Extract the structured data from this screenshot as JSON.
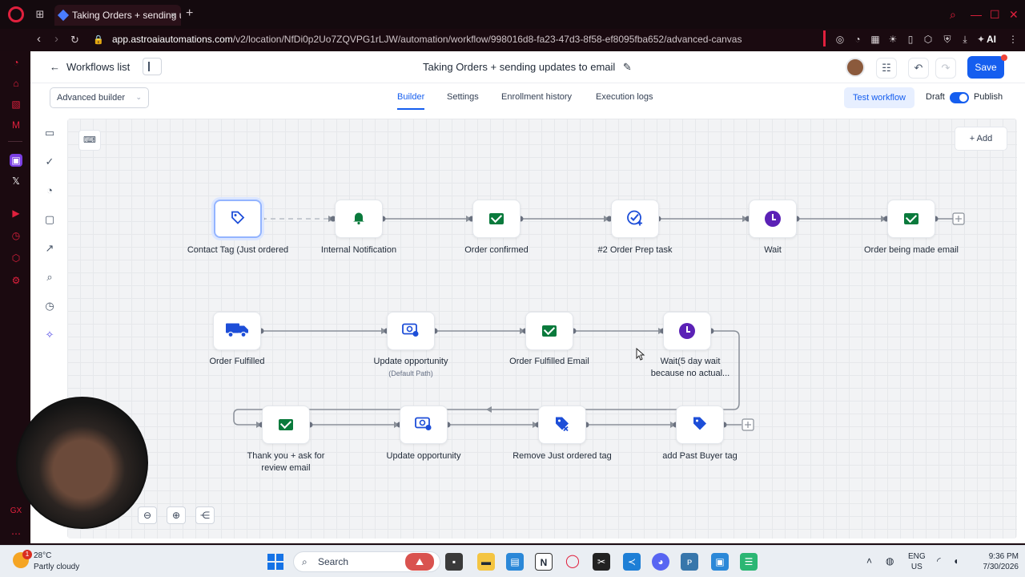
{
  "browser": {
    "tab_title": "Taking Orders + sending up",
    "url_host": "app.astroaiautomations.com",
    "url_path": "/v2/location/NfDi0p2Uo7ZQVPG1rLJW/automation/workflow/998016d8-fa23-47d3-8f58-ef8095fba652/advanced-canvas",
    "ai_label": "AI"
  },
  "header": {
    "back_label": "Workflows list",
    "workflow_title": "Taking Orders + sending updates to email",
    "save_label": "Save"
  },
  "subbar": {
    "builder_mode": "Advanced builder",
    "tabs": [
      "Builder",
      "Settings",
      "Enrollment history",
      "Execution logs"
    ],
    "active_tab": "Builder",
    "test_label": "Test workflow",
    "draft_label": "Draft",
    "publish_label": "Publish",
    "published": true
  },
  "canvas": {
    "add_label": "Add"
  },
  "nodes": {
    "contact_tag": "Contact Tag (Just ordered",
    "internal_notification": "Internal Notification",
    "order_confirmed": "Order confirmed",
    "order_prep": "#2 Order Prep task",
    "wait1": "Wait",
    "order_being_made": "Order being made email",
    "order_fulfilled": "Order Fulfilled",
    "update_opportunity1": "Update opportunity",
    "update_opportunity1_sub": "(Default Path)",
    "order_fulfilled_email": "Order Fulfilled Email",
    "wait2": "Wait(5 day wait because no actual...",
    "thank_you": "Thank you + ask for review email",
    "update_opportunity2": "Update opportunity",
    "remove_tag": "Remove Just ordered tag",
    "add_past_buyer": "add Past Buyer tag"
  },
  "colors": {
    "accent": "#155eef",
    "email_green": "#0a7a3c",
    "wait_purple": "#5b21b6",
    "opera_red": "#e0203d"
  },
  "taskbar": {
    "temperature": "28°C",
    "weather": "Partly cloudy",
    "weather_badge": "1",
    "search_label": "Search",
    "language": "ENG",
    "region": "US",
    "time": "9:36 PM",
    "date": "7/30/2026"
  }
}
